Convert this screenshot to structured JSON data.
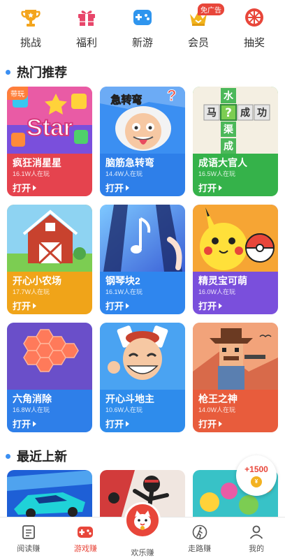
{
  "top_nav": [
    {
      "label": "挑战",
      "icon": "trophy-icon",
      "color": "#f3a51d"
    },
    {
      "label": "福利",
      "icon": "gift-icon",
      "color": "#e8466a"
    },
    {
      "label": "新游",
      "icon": "gamepad-icon",
      "color": "#2f95ee"
    },
    {
      "label": "会员",
      "icon": "crown-icon",
      "color": "#f1b41c",
      "badge": "免广告"
    },
    {
      "label": "抽奖",
      "icon": "lottery-wheel-icon",
      "color": "#e8463a"
    }
  ],
  "sections": {
    "hot": "热门推荐",
    "recent": "最近上新"
  },
  "games": [
    {
      "name": "疯狂消星星",
      "players": "16.1W人在玩",
      "open": "打开",
      "bg": "#e5434e",
      "art": "star",
      "tag": "带玩"
    },
    {
      "name": "脑筋急转弯",
      "players": "14.4W人在玩",
      "open": "打开",
      "bg": "#2e7fe9",
      "art": "einstein",
      "art_text": "急转弯"
    },
    {
      "name": "成语大官人",
      "players": "16.5W人在玩",
      "open": "打开",
      "bg": "#35b24a",
      "art": "idiom",
      "idiom_chars": [
        "水",
        "马",
        "?",
        "成",
        "功",
        "渠",
        "成"
      ]
    },
    {
      "name": "开心小农场",
      "players": "17.7W人在玩",
      "open": "打开",
      "bg": "#f0a419",
      "art": "farm"
    },
    {
      "name": "钢琴块2",
      "players": "16.1W人在玩",
      "open": "打开",
      "bg": "#2f86ee",
      "art": "piano"
    },
    {
      "name": "精灵宝可萌",
      "players": "16.0W人在玩",
      "open": "打开",
      "bg": "#7a4fdc",
      "art": "pokemon"
    },
    {
      "name": "六角消除",
      "players": "16.8W人在玩",
      "open": "打开",
      "bg": "#2e7fe9",
      "art": "hexagon"
    },
    {
      "name": "开心斗地主",
      "players": "10.6W人在玩",
      "open": "打开",
      "bg": "#2e8cec",
      "art": "doudizhu"
    },
    {
      "name": "枪王之神",
      "players": "14.0W人在玩",
      "open": "打开",
      "bg": "#e85c3c",
      "art": "gunman"
    }
  ],
  "recent_games": [
    {
      "art": "racing-car",
      "bg": "#1e5fd6"
    },
    {
      "art": "stickman",
      "bg": "#d23b3b"
    },
    {
      "art": "bubbles",
      "bg": "#38c2c7"
    }
  ],
  "coin_bubble": {
    "amount": "+1500",
    "icon": "coin-icon",
    "coin_symbol": "¥"
  },
  "tabs": [
    {
      "label": "阅读赚",
      "icon": "book-icon",
      "active": false
    },
    {
      "label": "游戏赚",
      "icon": "gamepad-icon",
      "active": true
    },
    {
      "label": "欢乐赚",
      "icon": "lucky-cat-icon",
      "active": false
    },
    {
      "label": "走路赚",
      "icon": "walking-icon",
      "active": false
    },
    {
      "label": "我的",
      "icon": "person-icon",
      "active": false
    }
  ],
  "colors": {
    "accent": "#e8463a",
    "section_dot": "#3b8ff2"
  }
}
